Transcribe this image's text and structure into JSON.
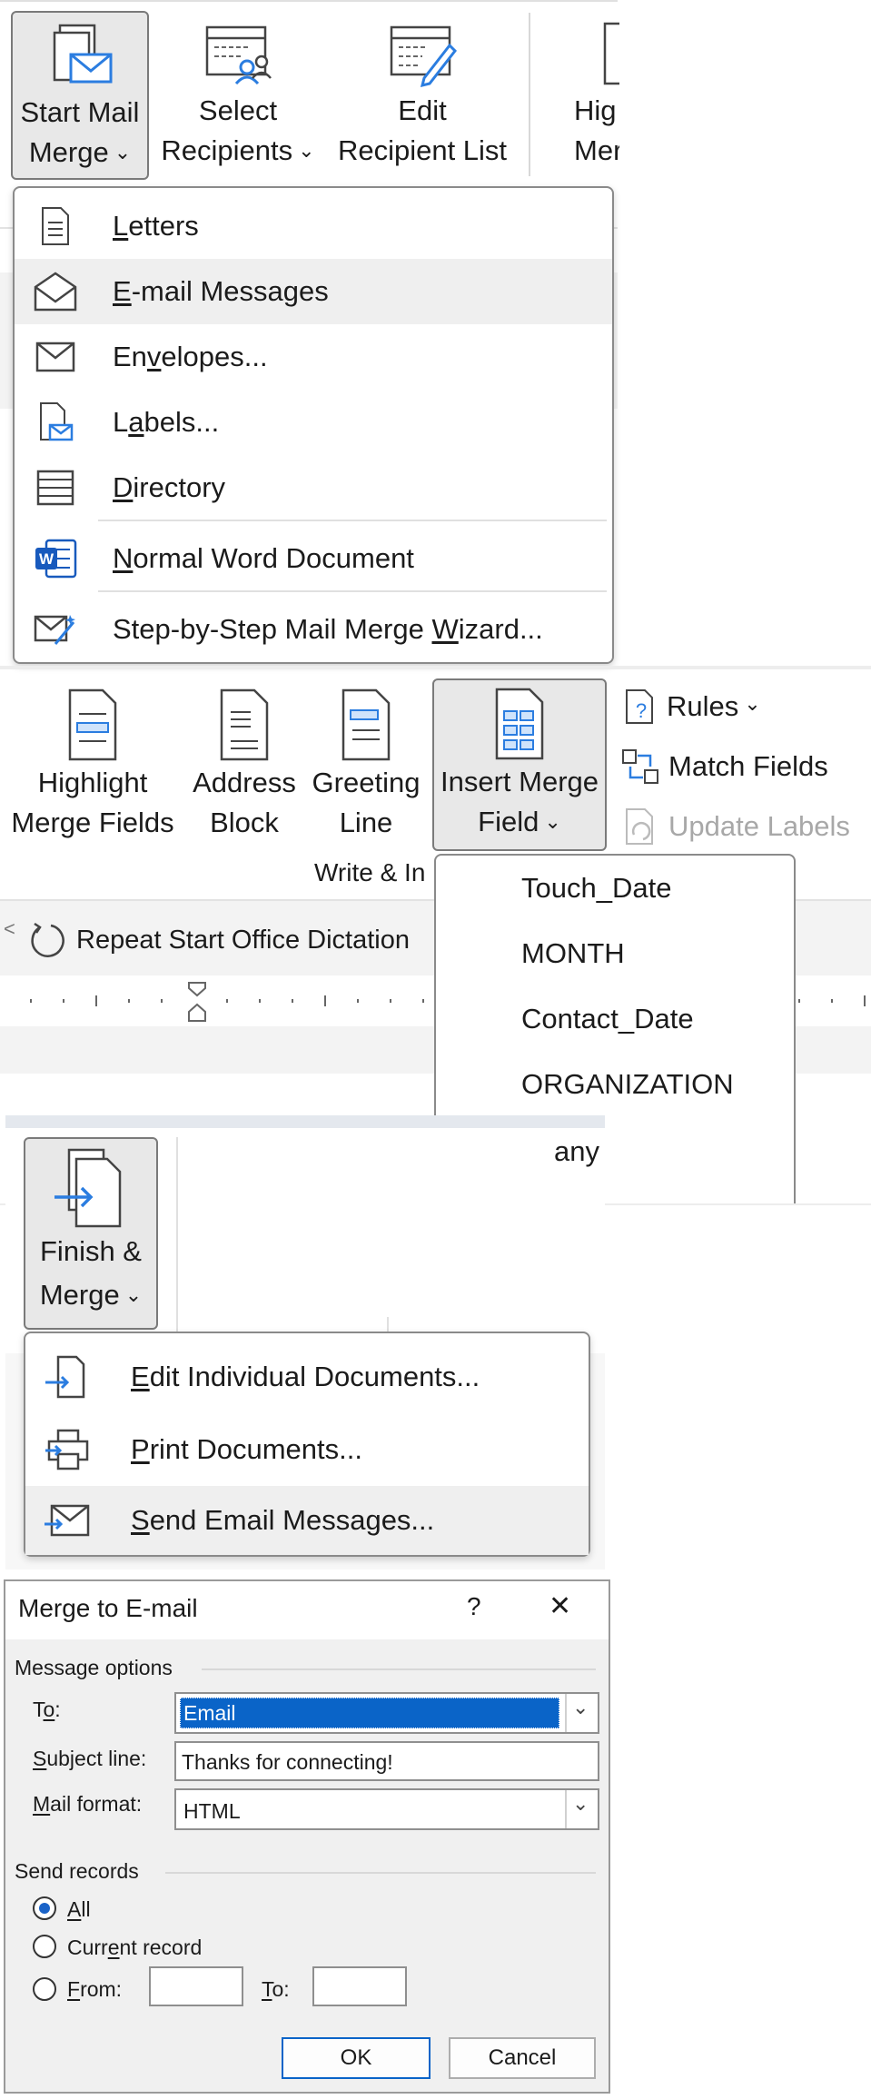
{
  "panel1": {
    "buttons": {
      "start_mail_merge": [
        "Start Mail",
        "Merge"
      ],
      "select_recipients": [
        "Select",
        "Recipients"
      ],
      "edit_recipient_list": [
        "Edit",
        "Recipient List"
      ],
      "highlight_partial": [
        "Hig",
        "Merg"
      ]
    },
    "menu": [
      {
        "pre": "",
        "acc": "L",
        "post": "etters",
        "icon": "document-icon"
      },
      {
        "pre": "",
        "acc": "E",
        "post": "-mail Messages",
        "icon": "envelope-open-icon",
        "highlighted": true
      },
      {
        "pre": "En",
        "acc": "v",
        "post": "elopes...",
        "icon": "envelope-icon"
      },
      {
        "pre": "L",
        "acc": "a",
        "post": "bels...",
        "icon": "labels-icon"
      },
      {
        "pre": "",
        "acc": "D",
        "post": "irectory",
        "icon": "directory-icon"
      },
      {
        "pre": "",
        "acc": "N",
        "post": "ormal Word Document",
        "icon": "word-icon"
      },
      {
        "pre": "Step-by-Step Mail Merge ",
        "acc": "W",
        "post": "izard...",
        "icon": "wizard-icon"
      }
    ]
  },
  "panel2": {
    "buttons": {
      "highlight_merge_fields": [
        "Highlight",
        "Merge Fields"
      ],
      "address_block": [
        "Address",
        "Block"
      ],
      "greeting_line": [
        "Greeting",
        "Line"
      ],
      "insert_merge_field": [
        "Insert Merge",
        "Field"
      ]
    },
    "small_buttons": {
      "rules": "Rules",
      "match_fields": "Match Fields",
      "update_labels": "Update Labels"
    },
    "group_label_partial": "Write & In",
    "dictation": "Repeat Start Office Dictation",
    "fields": [
      "Touch_Date",
      "MONTH",
      "Contact_Date",
      "ORGANIZATION"
    ],
    "partial_field": "any"
  },
  "panel3": {
    "button": [
      "Finish &",
      "Merge"
    ],
    "menu": [
      {
        "pre": "",
        "acc": "E",
        "post": "dit Individual Documents...",
        "icon": "edit-documents-icon"
      },
      {
        "pre": "",
        "acc": "P",
        "post": "rint Documents...",
        "icon": "printer-icon"
      },
      {
        "pre": "",
        "acc": "S",
        "post": "end Email Messages...",
        "icon": "send-email-icon",
        "highlighted": true
      }
    ]
  },
  "dialog": {
    "title": "Merge to E-mail",
    "help": "?",
    "close": "✕",
    "message_options": "Message options",
    "to_label": {
      "pre": "T",
      "acc": "o",
      "post": ":"
    },
    "to_value": "Email",
    "subject_label": {
      "pre": "",
      "acc": "S",
      "post": "ubject line:"
    },
    "subject_value": "Thanks for connecting!",
    "format_label": {
      "pre": "",
      "acc": "M",
      "post": "ail format:"
    },
    "format_value": "HTML",
    "send_records": "Send records",
    "radio_all": {
      "pre": "",
      "acc": "A",
      "post": "ll"
    },
    "radio_current": {
      "pre": "Curr",
      "acc": "e",
      "post": "nt record"
    },
    "radio_from": {
      "pre": "",
      "acc": "F",
      "post": "rom:"
    },
    "radio_to": {
      "pre": "",
      "acc": "T",
      "post": "o:"
    },
    "ok": "OK",
    "cancel": "Cancel"
  },
  "colors": {
    "accent": "#0a64c8",
    "selection": "#0a64c8",
    "ribbon_blue": "#3a8ee6"
  }
}
